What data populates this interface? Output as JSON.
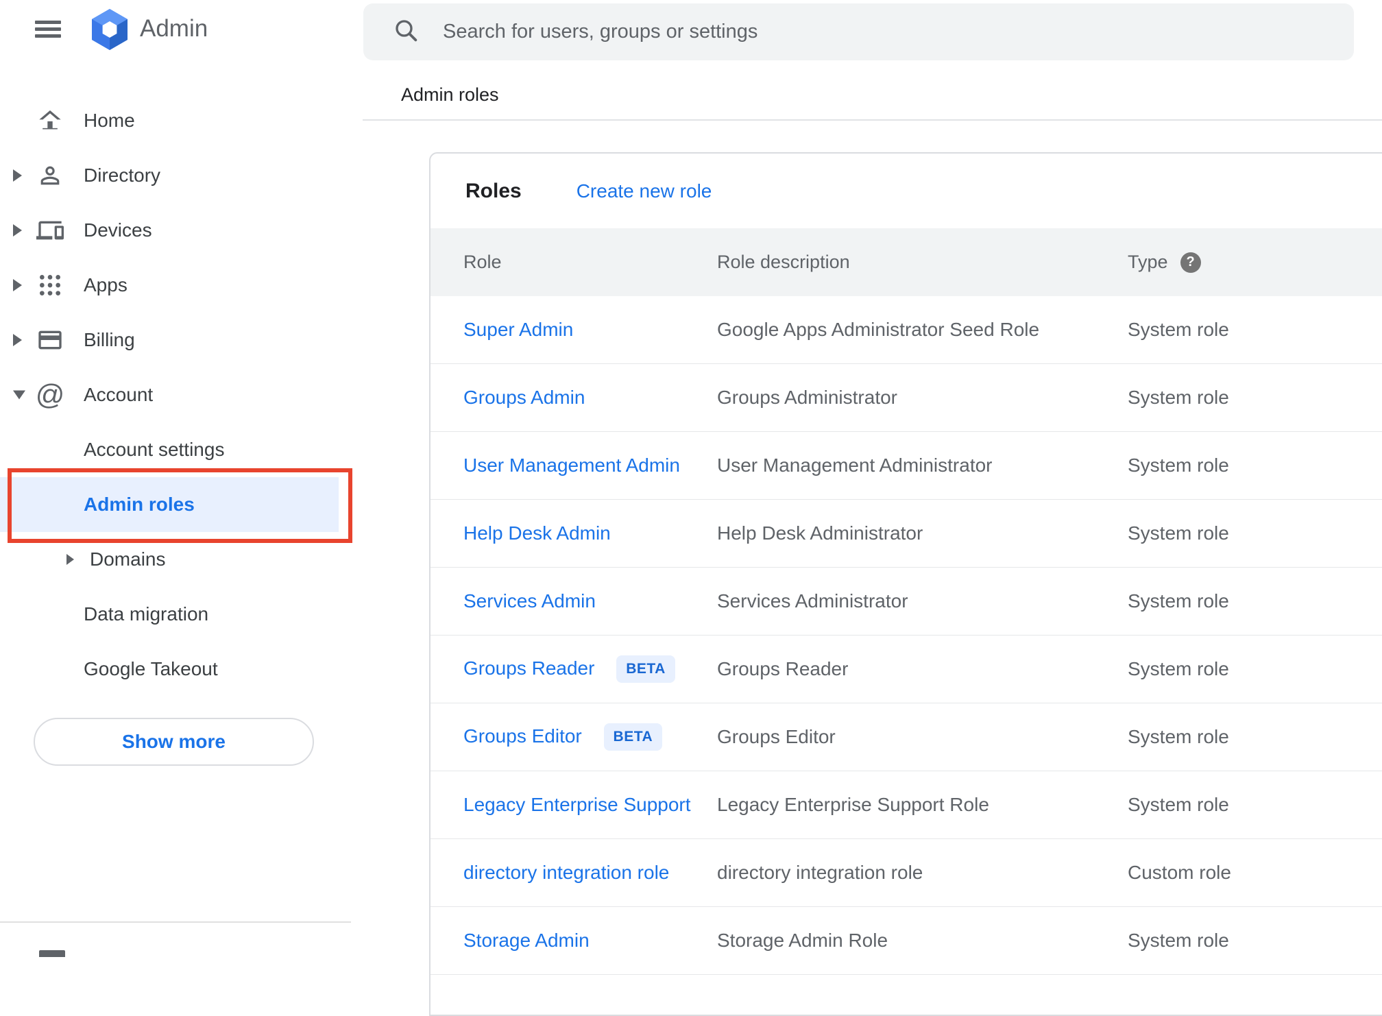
{
  "header": {
    "app_name": "Admin",
    "search_placeholder": "Search for users, groups or settings"
  },
  "breadcrumb": {
    "title": "Admin roles"
  },
  "sidebar": {
    "items": [
      {
        "label": "Home",
        "icon": "home-icon",
        "expandable": false
      },
      {
        "label": "Directory",
        "icon": "person-icon",
        "expandable": true
      },
      {
        "label": "Devices",
        "icon": "devices-icon",
        "expandable": true
      },
      {
        "label": "Apps",
        "icon": "apps-grid-icon",
        "expandable": true
      },
      {
        "label": "Billing",
        "icon": "credit-card-icon",
        "expandable": true
      },
      {
        "label": "Account",
        "icon": "at-sign-icon",
        "expanded": true
      }
    ],
    "account_items": [
      {
        "label": "Account settings",
        "selected": false
      },
      {
        "label": "Admin roles",
        "selected": true,
        "annotated": true
      },
      {
        "label": "Domains",
        "expandable": true
      },
      {
        "label": "Data migration",
        "selected": false
      },
      {
        "label": "Google Takeout",
        "selected": false
      }
    ],
    "show_more_label": "Show more"
  },
  "main": {
    "card_title": "Roles",
    "create_link_label": "Create new role",
    "table": {
      "columns": [
        "Role",
        "Role description",
        "Type"
      ],
      "help_icon_text": "?",
      "rows": [
        {
          "role": "Super Admin",
          "description": "Google Apps Administrator Seed Role",
          "type": "System role"
        },
        {
          "role": "Groups Admin",
          "description": "Groups Administrator",
          "type": "System role"
        },
        {
          "role": "User Management Admin",
          "description": "User Management Administrator",
          "type": "System role"
        },
        {
          "role": "Help Desk Admin",
          "description": "Help Desk Administrator",
          "type": "System role"
        },
        {
          "role": "Services Admin",
          "description": "Services Administrator",
          "type": "System role"
        },
        {
          "role": "Groups Reader",
          "beta_label": "BETA",
          "description": "Groups Reader",
          "type": "System role"
        },
        {
          "role": "Groups Editor",
          "beta_label": "BETA",
          "description": "Groups Editor",
          "type": "System role"
        },
        {
          "role": "Legacy Enterprise Support",
          "description": "Legacy Enterprise Support Role",
          "type": "System role"
        },
        {
          "role": "directory integration role",
          "description": "directory integration role",
          "type": "Custom role"
        },
        {
          "role": "Storage Admin",
          "description": "Storage Admin Role",
          "type": "System role"
        }
      ]
    }
  },
  "colors": {
    "accent_blue": "#1a73e8",
    "selected_bg": "#e8f0fe",
    "annotation_red": "#e8442e",
    "table_header_bg": "#f1f3f4",
    "icon_gray": "#5f6368",
    "text_dark": "#202124"
  }
}
